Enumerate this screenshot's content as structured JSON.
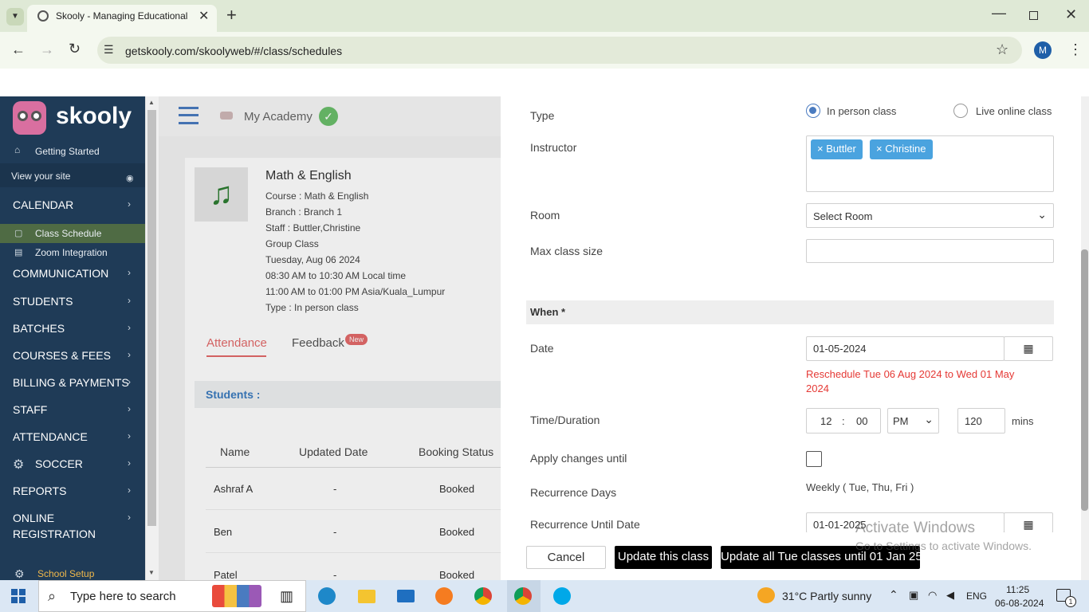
{
  "browser": {
    "tab_title": "Skooly - Managing Educational",
    "url": "getskooly.com/skoolyweb/#/class/schedules",
    "profile_initial": "M"
  },
  "sidebar": {
    "brand": "skooly",
    "items": [
      {
        "label": "Getting Started"
      },
      {
        "label": "View your site"
      },
      {
        "label": "CALENDAR"
      },
      {
        "label": "Class Schedule"
      },
      {
        "label": "Zoom Integration"
      },
      {
        "label": "COMMUNICATION"
      },
      {
        "label": "STUDENTS"
      },
      {
        "label": "BATCHES"
      },
      {
        "label": "COURSES & FEES"
      },
      {
        "label": "BILLING & PAYMENTS"
      },
      {
        "label": "STAFF"
      },
      {
        "label": "ATTENDANCE"
      },
      {
        "label": "SOCCER"
      },
      {
        "label": "REPORTS"
      },
      {
        "label": "ONLINE"
      },
      {
        "label": "REGISTRATION"
      },
      {
        "label": "School Setup"
      }
    ]
  },
  "header": {
    "academy": "My Academy"
  },
  "class_card": {
    "title": "Math & English",
    "course": "Course : Math & English",
    "branch": "Branch : Branch 1",
    "staff": "Staff : Buttler,Christine",
    "group": "Group Class",
    "date": "Tuesday, Aug 06 2024",
    "local_time": "08:30 AM to 10:30 AM Local time",
    "tz_time": "11:00 AM to 01:00 PM Asia/Kuala_Lumpur",
    "type": "Type : In person class",
    "tabs": [
      "Attendance",
      "Feedback"
    ],
    "new_badge": "New",
    "students_label": "Students :",
    "columns": [
      "Name",
      "Updated Date",
      "Booking Status"
    ],
    "rows": [
      {
        "name": "Ashraf A",
        "updated": "-",
        "status": "Booked"
      },
      {
        "name": "Ben",
        "updated": "-",
        "status": "Booked"
      },
      {
        "name": "Patel",
        "updated": "-",
        "status": "Booked"
      }
    ]
  },
  "form": {
    "type_label": "Type",
    "type_options": [
      "In person class",
      "Live online class"
    ],
    "instructor_label": "Instructor",
    "instructors": [
      "Buttler",
      "Christine"
    ],
    "room_label": "Room",
    "room_value": "Select Room",
    "max_size_label": "Max class size",
    "when_label": "When *",
    "date_label": "Date",
    "date_value": "01-05-2024",
    "reschedule_1": "Reschedule Tue 06 Aug 2024 to Wed 01 May",
    "reschedule_2": "2024",
    "time_label": "Time/Duration",
    "hour": "12",
    "colon": ":",
    "minute": "00",
    "ampm": "PM",
    "duration": "120",
    "mins": "mins",
    "apply_label": "Apply changes until",
    "recurrence_label": "Recurrence Days",
    "recurrence_value": "Weekly ( Tue, Thu, Fri )",
    "recurrence_until_label": "Recurrence Until Date",
    "recurrence_until_value": "01-01-2025",
    "cancel": "Cancel",
    "update_one": "Update this class",
    "update_all": "Update all Tue classes until 01 Jan 25"
  },
  "watermark": {
    "line1": "Activate Windows",
    "line2": "Go to Settings to activate Windows."
  },
  "taskbar": {
    "search_placeholder": "Type here to search",
    "weather": "31°C  Partly sunny",
    "lang": "ENG",
    "time": "11:25",
    "date": "06-08-2024",
    "notif_count": "1"
  },
  "colors": {
    "sidebar": "#1f3b57",
    "accent_green": "#9dba6e",
    "tag_blue": "#4aa3df",
    "error_red": "#e53935"
  }
}
